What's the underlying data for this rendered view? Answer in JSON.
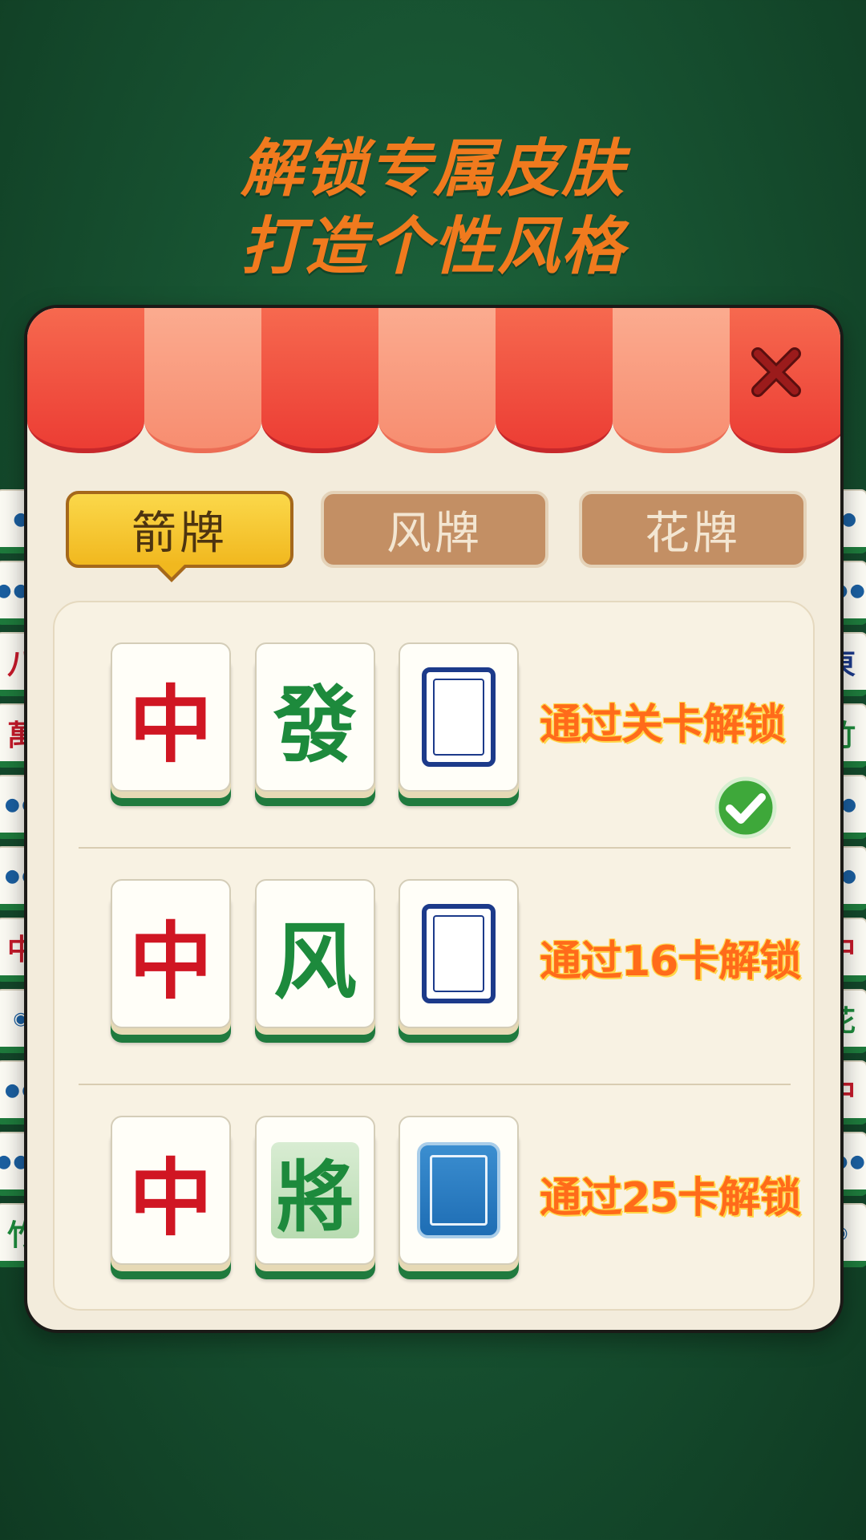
{
  "headline": {
    "line1": "解锁专属皮肤",
    "line2": "打造个性风格"
  },
  "tabs": [
    {
      "label": "箭牌",
      "active": true
    },
    {
      "label": "风牌",
      "active": false
    },
    {
      "label": "花牌",
      "active": false
    }
  ],
  "rows": [
    {
      "tiles": [
        "中",
        "發",
        "blank-frame-tile"
      ],
      "unlock_text": "通过关卡解锁",
      "unlocked": true
    },
    {
      "tiles": [
        "中",
        "风",
        "blank-frame-tile"
      ],
      "unlock_text": "通过16卡解锁",
      "unlocked": false
    },
    {
      "tiles": [
        "中",
        "將",
        "blank-blue-tile"
      ],
      "unlock_text": "通过25卡解锁",
      "unlocked": false
    }
  ],
  "side_tiles": {
    "left": [
      "●",
      "●●●",
      "八",
      "萬",
      "●●",
      "●●",
      "中",
      "◉",
      "●●",
      "●●●",
      "竹"
    ],
    "right": [
      "●●",
      "●●●",
      "東",
      "竹",
      "●●",
      "●●",
      "中",
      "花",
      "中",
      "●●●",
      "◉"
    ]
  },
  "colors": {
    "accent": "#f07a1e",
    "unlock_text": "#ff6b1a",
    "tab_active": "#f1b81f",
    "tab_inactive": "#c38f64",
    "awning_red": "#ec3d34"
  },
  "icons": {
    "close": "close-x-icon",
    "check": "checkmark-icon"
  }
}
